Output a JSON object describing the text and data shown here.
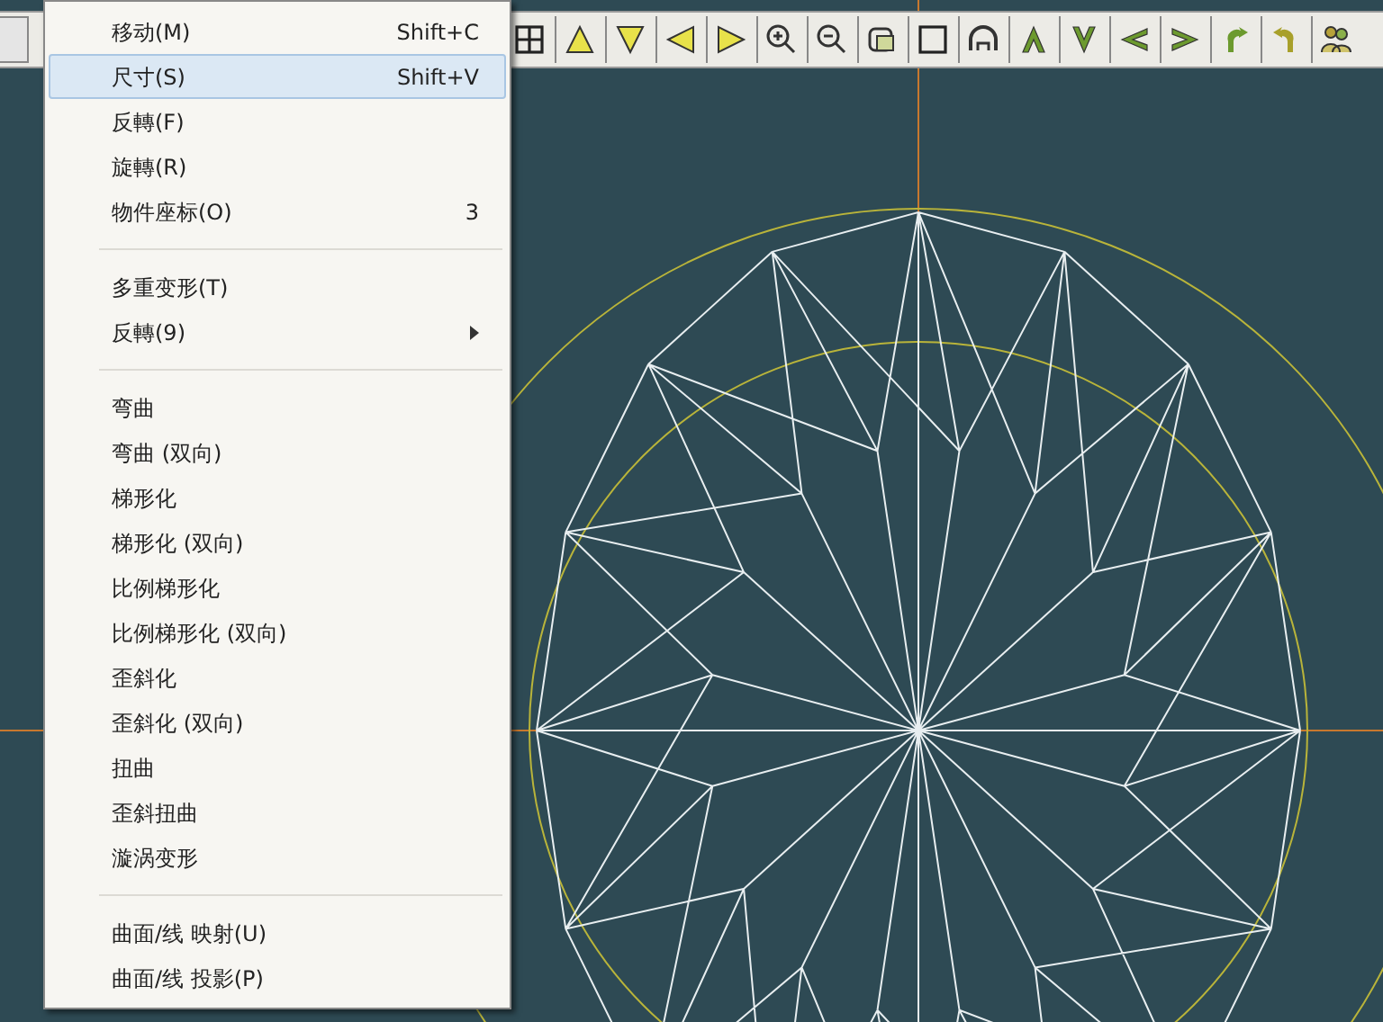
{
  "menu": {
    "items": [
      {
        "kind": "item",
        "label": "移动(M)",
        "shortcut": "Shift+C",
        "selected": false
      },
      {
        "kind": "item",
        "label": "尺寸(S)",
        "shortcut": "Shift+V",
        "selected": true
      },
      {
        "kind": "item",
        "label": "反轉(F)",
        "selected": false
      },
      {
        "kind": "item",
        "label": "旋轉(R)",
        "selected": false
      },
      {
        "kind": "item",
        "label": "物件座标(O)",
        "shortcut": "3",
        "selected": false
      },
      {
        "kind": "separator"
      },
      {
        "kind": "item",
        "label": "多重变形(T)",
        "selected": false
      },
      {
        "kind": "submenu",
        "label": "反轉(9)",
        "selected": false
      },
      {
        "kind": "separator"
      },
      {
        "kind": "item",
        "label": "弯曲",
        "selected": false
      },
      {
        "kind": "item",
        "label": "弯曲 (双向)",
        "selected": false
      },
      {
        "kind": "item",
        "label": "梯形化",
        "selected": false
      },
      {
        "kind": "item",
        "label": "梯形化 (双向)",
        "selected": false
      },
      {
        "kind": "item",
        "label": "比例梯形化",
        "selected": false
      },
      {
        "kind": "item",
        "label": "比例梯形化 (双向)",
        "selected": false
      },
      {
        "kind": "item",
        "label": "歪斜化",
        "selected": false
      },
      {
        "kind": "item",
        "label": "歪斜化 (双向)",
        "selected": false
      },
      {
        "kind": "item",
        "label": "扭曲",
        "selected": false
      },
      {
        "kind": "item",
        "label": "歪斜扭曲",
        "selected": false
      },
      {
        "kind": "item",
        "label": "漩涡变形",
        "selected": false
      },
      {
        "kind": "separator"
      },
      {
        "kind": "item",
        "label": "曲面/线 映射(U)",
        "selected": false
      },
      {
        "kind": "item",
        "label": "曲面/线 投影(P)",
        "selected": false
      }
    ]
  }
}
